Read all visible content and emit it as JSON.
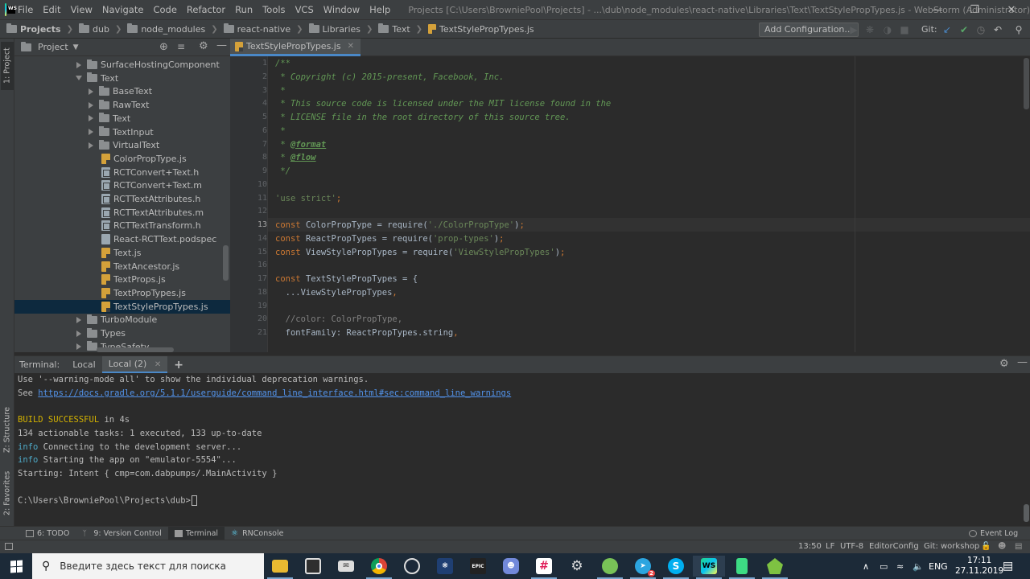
{
  "menubar": {
    "logo_text": "WS",
    "items": [
      "File",
      "Edit",
      "View",
      "Navigate",
      "Code",
      "Refactor",
      "Run",
      "Tools",
      "VCS",
      "Window",
      "Help"
    ],
    "window_title": "Projects [C:\\Users\\BrowniePool\\Projects] - ...\\dub\\node_modules\\react-native\\Libraries\\Text\\TextStylePropTypes.js - WebStorm (Administrator)"
  },
  "navbar": {
    "crumbs": [
      "Projects",
      "dub",
      "node_modules",
      "react-native",
      "Libraries",
      "Text",
      "TextStylePropTypes.js"
    ],
    "add_config": "Add Configuration...",
    "git_label": "Git:"
  },
  "left_stripe": {
    "project_tab": "1: Project",
    "structure_tab": "Z: Structure",
    "favorites_tab": "2: Favorites"
  },
  "project_panel": {
    "title": "Project",
    "rows": [
      {
        "label": "SurfaceHostingComponent",
        "kind": "folder",
        "state": "collapsed",
        "depth": 1
      },
      {
        "label": "Text",
        "kind": "folder",
        "state": "expanded",
        "depth": 1
      },
      {
        "label": "BaseText",
        "kind": "folder",
        "state": "collapsed",
        "depth": 2
      },
      {
        "label": "RawText",
        "kind": "folder",
        "state": "collapsed",
        "depth": 2
      },
      {
        "label": "Text",
        "kind": "folder",
        "state": "collapsed",
        "depth": 2
      },
      {
        "label": "TextInput",
        "kind": "folder",
        "state": "collapsed",
        "depth": 2
      },
      {
        "label": "VirtualText",
        "kind": "folder",
        "state": "collapsed",
        "depth": 2
      },
      {
        "label": "ColorPropType.js",
        "kind": "js",
        "depth": 2
      },
      {
        "label": "RCTConvert+Text.h",
        "kind": "h",
        "depth": 2
      },
      {
        "label": "RCTConvert+Text.m",
        "kind": "h",
        "depth": 2
      },
      {
        "label": "RCTTextAttributes.h",
        "kind": "h",
        "depth": 2
      },
      {
        "label": "RCTTextAttributes.m",
        "kind": "h",
        "depth": 2
      },
      {
        "label": "RCTTextTransform.h",
        "kind": "h",
        "depth": 2
      },
      {
        "label": "React-RCTText.podspec",
        "kind": "spec",
        "depth": 2
      },
      {
        "label": "Text.js",
        "kind": "js",
        "depth": 2
      },
      {
        "label": "TextAncestor.js",
        "kind": "js",
        "depth": 2
      },
      {
        "label": "TextProps.js",
        "kind": "js",
        "depth": 2
      },
      {
        "label": "TextPropTypes.js",
        "kind": "js",
        "depth": 2
      },
      {
        "label": "TextStylePropTypes.js",
        "kind": "js",
        "depth": 2,
        "selected": true
      },
      {
        "label": "TurboModule",
        "kind": "folder",
        "state": "collapsed",
        "depth": 1
      },
      {
        "label": "Types",
        "kind": "folder",
        "state": "collapsed",
        "depth": 1
      },
      {
        "label": "TypeSafety",
        "kind": "folder",
        "state": "collapsed",
        "depth": 1
      }
    ]
  },
  "editor": {
    "tab_label": "TextStylePropTypes.js",
    "current_line": 13,
    "line_numbers": [
      "1",
      "2",
      "3",
      "4",
      "5",
      "6",
      "7",
      "8",
      "9",
      "10",
      "11",
      "12",
      "13",
      "14",
      "15",
      "16",
      "17",
      "18",
      "19",
      "20",
      "21"
    ],
    "lines": [
      [
        {
          "t": "/**",
          "c": "cmt"
        }
      ],
      [
        {
          "t": " * Copyright (c) 2015-present, Facebook, Inc.",
          "c": "cmt"
        }
      ],
      [
        {
          "t": " *",
          "c": "cmt"
        }
      ],
      [
        {
          "t": " * This source code is licensed under the MIT license found in the",
          "c": "cmt"
        }
      ],
      [
        {
          "t": " * LICENSE file in the root directory of this source tree.",
          "c": "cmt"
        }
      ],
      [
        {
          "t": " *",
          "c": "cmt"
        }
      ],
      [
        {
          "t": " * ",
          "c": "cmt"
        },
        {
          "t": "@format",
          "c": "tag"
        }
      ],
      [
        {
          "t": " * ",
          "c": "cmt"
        },
        {
          "t": "@flow",
          "c": "tag"
        }
      ],
      [
        {
          "t": " */",
          "c": "cmt"
        }
      ],
      [],
      [
        {
          "t": "'use strict'",
          "c": "str"
        },
        {
          "t": ";",
          "c": "kw"
        }
      ],
      [],
      [
        {
          "t": "const ",
          "c": "kw"
        },
        {
          "t": "ColorPropType = require(",
          "c": ""
        },
        {
          "t": "'./ColorPropType'",
          "c": "str"
        },
        {
          "t": ")",
          "c": ""
        },
        {
          "t": ";",
          "c": "kw"
        }
      ],
      [
        {
          "t": "const ",
          "c": "kw"
        },
        {
          "t": "ReactPropTypes = require(",
          "c": ""
        },
        {
          "t": "'prop-types'",
          "c": "str"
        },
        {
          "t": ")",
          "c": ""
        },
        {
          "t": ";",
          "c": "kw"
        }
      ],
      [
        {
          "t": "const ",
          "c": "kw"
        },
        {
          "t": "ViewStylePropTypes = require(",
          "c": ""
        },
        {
          "t": "'ViewStylePropTypes'",
          "c": "str"
        },
        {
          "t": ")",
          "c": ""
        },
        {
          "t": ";",
          "c": "kw"
        }
      ],
      [],
      [
        {
          "t": "const ",
          "c": "kw"
        },
        {
          "t": "TextStylePropTypes = {",
          "c": ""
        }
      ],
      [
        {
          "t": "  ...ViewStylePropTypes",
          "c": ""
        },
        {
          "t": ",",
          "c": "kw"
        }
      ],
      [],
      [
        {
          "t": "  //color: ColorPropType,",
          "c": "gcmt"
        }
      ],
      [
        {
          "t": "  fontFamily: ReactPropTypes.string",
          "c": ""
        },
        {
          "t": ",",
          "c": "kw"
        }
      ]
    ]
  },
  "terminal": {
    "label": "Terminal:",
    "tabs": [
      "Local",
      "Local (2)"
    ],
    "active_tab": 1,
    "add_symbol": "+",
    "lines": [
      [
        {
          "t": "Use '--warning-mode all' to show the individual deprecation warnings.",
          "c": ""
        }
      ],
      [
        {
          "t": "See ",
          "c": ""
        },
        {
          "t": "https://docs.gradle.org/5.1.1/userguide/command_line_interface.html#sec:command_line_warnings",
          "c": "link"
        }
      ],
      [],
      [
        {
          "t": "BUILD SUCCESSFUL",
          "c": "yellow"
        },
        {
          "t": " in 4s",
          "c": ""
        }
      ],
      [
        {
          "t": "134 actionable tasks: 1 executed, 133 up-to-date",
          "c": ""
        }
      ],
      [
        {
          "t": "info",
          "c": "cyan"
        },
        {
          "t": " Connecting to the development server...",
          "c": ""
        }
      ],
      [
        {
          "t": "info",
          "c": "cyan"
        },
        {
          "t": " Starting the app on \"emulator-5554\"...",
          "c": ""
        }
      ],
      [
        {
          "t": "Starting: Intent { cmp=com.dabpumps/.MainActivity }",
          "c": ""
        }
      ],
      [],
      [
        {
          "t": "C:\\Users\\BrowniePool\\Projects\\dub>",
          "c": ""
        }
      ]
    ]
  },
  "tool_windows": {
    "todo": "6: TODO",
    "version_control": "9: Version Control",
    "terminal": "Terminal",
    "rnconsole": "RNConsole",
    "event_log": "Event Log"
  },
  "status_bar": {
    "position": "13:50",
    "line_sep": "LF",
    "encoding": "UTF-8",
    "editor_config": "EditorConfig",
    "git_branch": "Git: workshop"
  },
  "taskbar": {
    "search_placeholder": "Введите здесь текст для поиска",
    "lang": "ENG",
    "time": "17:11",
    "date": "27.11.2019",
    "notification_badge": "2"
  },
  "colors": {
    "accent": "#4a88c7",
    "selection": "#0d293e",
    "comment": "#629755",
    "string": "#6a8759",
    "keyword": "#cc7832"
  }
}
